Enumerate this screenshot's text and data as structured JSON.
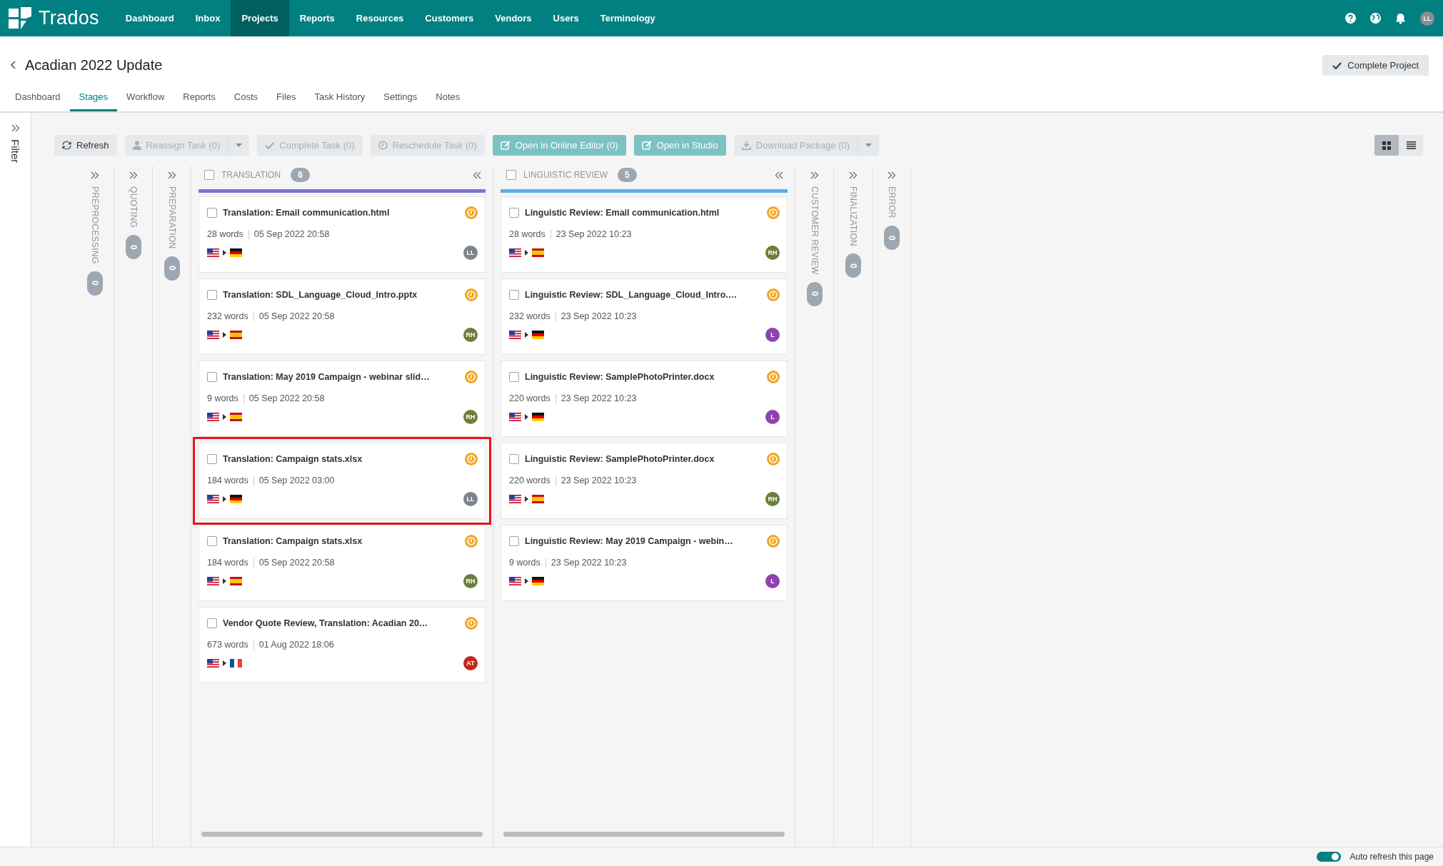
{
  "top_bar": {
    "brand": "Trados",
    "nav": [
      {
        "label": "Dashboard",
        "selected": false
      },
      {
        "label": "Inbox",
        "selected": false
      },
      {
        "label": "Projects",
        "selected": true
      },
      {
        "label": "Reports",
        "selected": false
      },
      {
        "label": "Resources",
        "selected": false
      },
      {
        "label": "Customers",
        "selected": false
      },
      {
        "label": "Vendors",
        "selected": false
      },
      {
        "label": "Users",
        "selected": false
      },
      {
        "label": "Terminology",
        "selected": false
      }
    ],
    "user_avatar": "LL"
  },
  "project": {
    "title": "Acadian 2022 Update",
    "complete_button": "Complete Project"
  },
  "tabs": [
    {
      "label": "Dashboard",
      "selected": false
    },
    {
      "label": "Stages",
      "selected": true
    },
    {
      "label": "Workflow",
      "selected": false
    },
    {
      "label": "Reports",
      "selected": false
    },
    {
      "label": "Costs",
      "selected": false
    },
    {
      "label": "Files",
      "selected": false
    },
    {
      "label": "Task History",
      "selected": false
    },
    {
      "label": "Settings",
      "selected": false
    },
    {
      "label": "Notes",
      "selected": false
    }
  ],
  "filter_panel": {
    "label": "Filter"
  },
  "toolbar": {
    "buttons": [
      {
        "label": "Refresh",
        "kind": "refresh",
        "disabled": false,
        "primary": false,
        "split": false
      },
      {
        "label": "Reassign Task (0)",
        "kind": "user",
        "disabled": true,
        "primary": false,
        "split": true
      },
      {
        "label": "Complete Task (0)",
        "kind": "check",
        "disabled": true,
        "primary": false,
        "split": false
      },
      {
        "label": "Reschedule Task (0)",
        "kind": "clock",
        "disabled": true,
        "primary": false,
        "split": false
      },
      {
        "label": "Open in Online Editor (0)",
        "kind": "edit",
        "disabled": false,
        "primary": true,
        "split": false
      },
      {
        "label": "Open in Studio",
        "kind": "edit",
        "disabled": false,
        "primary": true,
        "split": false
      },
      {
        "label": "Download Package (0)",
        "kind": "download",
        "disabled": true,
        "primary": false,
        "split": true
      }
    ],
    "views": [
      {
        "kind": "grid",
        "selected": true
      },
      {
        "kind": "list",
        "selected": false
      }
    ]
  },
  "stages": [
    {
      "kind": "collapsed",
      "name": "PREPROCESSING",
      "count": "0"
    },
    {
      "kind": "collapsed",
      "name": "QUOTING",
      "count": "0"
    },
    {
      "kind": "collapsed",
      "name": "PREPARATION",
      "count": "0"
    },
    {
      "kind": "expanded",
      "name": "TRANSLATION",
      "count": "6",
      "color": "#7b74d4",
      "checked": false,
      "cards": [
        {
          "title": "Translation: Email communication.html",
          "words": "28 words",
          "date": "05 Sep 2022 20:58",
          "flags": [
            {
              "kind": "us"
            },
            {
              "kind": "de"
            }
          ],
          "assignee": {
            "initials": "LL",
            "color": "#7d858b"
          },
          "checked": false,
          "highlighted": false
        },
        {
          "title": "Translation: SDL_Language_Cloud_Intro.pptx",
          "words": "232 words",
          "date": "05 Sep 2022 20:58",
          "flags": [
            {
              "kind": "us"
            },
            {
              "kind": "es"
            }
          ],
          "assignee": {
            "initials": "RH",
            "color": "#6b7f3a"
          },
          "checked": false,
          "highlighted": false
        },
        {
          "title": "Translation: May 2019 Campaign - webinar slid…",
          "words": "9 words",
          "date": "05 Sep 2022 20:58",
          "flags": [
            {
              "kind": "us"
            },
            {
              "kind": "es"
            }
          ],
          "assignee": {
            "initials": "RH",
            "color": "#6b7f3a"
          },
          "checked": false,
          "highlighted": false
        },
        {
          "title": "Translation: Campaign stats.xlsx",
          "words": "184 words",
          "date": "05 Sep 2022 03:00",
          "flags": [
            {
              "kind": "us"
            },
            {
              "kind": "de"
            }
          ],
          "assignee": {
            "initials": "LL",
            "color": "#7d858b"
          },
          "checked": false,
          "highlighted": true
        },
        {
          "title": "Translation: Campaign stats.xlsx",
          "words": "184 words",
          "date": "05 Sep 2022 20:58",
          "flags": [
            {
              "kind": "us"
            },
            {
              "kind": "es"
            }
          ],
          "assignee": {
            "initials": "RH",
            "color": "#6b7f3a"
          },
          "checked": false,
          "highlighted": false
        },
        {
          "title": "Vendor Quote Review, Translation: Acadian 20…",
          "words": "673 words",
          "date": "01 Aug 2022 18:06",
          "flags": [
            {
              "kind": "us"
            },
            {
              "kind": "fr"
            }
          ],
          "assignee": {
            "initials": "AT",
            "color": "#c0281b"
          },
          "checked": false,
          "highlighted": false
        }
      ]
    },
    {
      "kind": "expanded",
      "name": "LINGUISTIC REVIEW",
      "count": "5",
      "color": "#5aaeea",
      "checked": false,
      "cards": [
        {
          "title": "Linguistic Review: Email communication.html",
          "words": "28 words",
          "date": "23 Sep 2022 10:23",
          "flags": [
            {
              "kind": "us"
            },
            {
              "kind": "es"
            }
          ],
          "assignee": {
            "initials": "RH",
            "color": "#6b7f3a"
          },
          "checked": false,
          "highlighted": false
        },
        {
          "title": "Linguistic Review: SDL_Language_Cloud_Intro.…",
          "words": "232 words",
          "date": "23 Sep 2022 10:23",
          "flags": [
            {
              "kind": "us"
            },
            {
              "kind": "de"
            }
          ],
          "assignee": {
            "initials": "L",
            "color": "#8e44ad"
          },
          "checked": false,
          "highlighted": false
        },
        {
          "title": "Linguistic Review: SamplePhotoPrinter.docx",
          "words": "220 words",
          "date": "23 Sep 2022 10:23",
          "flags": [
            {
              "kind": "us"
            },
            {
              "kind": "de"
            }
          ],
          "assignee": {
            "initials": "L",
            "color": "#8e44ad"
          },
          "checked": false,
          "highlighted": false
        },
        {
          "title": "Linguistic Review: SamplePhotoPrinter.docx",
          "words": "220 words",
          "date": "23 Sep 2022 10:23",
          "flags": [
            {
              "kind": "us"
            },
            {
              "kind": "es"
            }
          ],
          "assignee": {
            "initials": "RH",
            "color": "#6b7f3a"
          },
          "checked": false,
          "highlighted": false
        },
        {
          "title": "Linguistic Review: May 2019 Campaign - webin…",
          "words": "9 words",
          "date": "23 Sep 2022 10:23",
          "flags": [
            {
              "kind": "us"
            },
            {
              "kind": "de"
            }
          ],
          "assignee": {
            "initials": "L",
            "color": "#8e44ad"
          },
          "checked": false,
          "highlighted": false
        }
      ]
    },
    {
      "kind": "collapsed",
      "name": "CUSTOMER REVIEW",
      "count": "0"
    },
    {
      "kind": "collapsed",
      "name": "FINALIZATION",
      "count": "0"
    },
    {
      "kind": "collapsed",
      "name": "ERROR",
      "count": "0"
    }
  ],
  "status_bar": {
    "auto_refresh": {
      "label": "Auto refresh this page",
      "on": true
    }
  }
}
